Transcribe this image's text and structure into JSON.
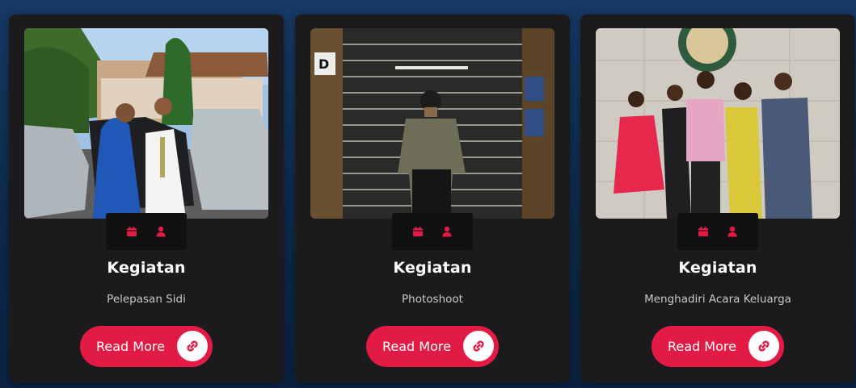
{
  "colors": {
    "accent": "#e21b45",
    "card_bg": "#1b1b1d",
    "meta_bg": "#111112",
    "page_bg": "#163a64"
  },
  "cards": [
    {
      "title": "Kegiatan",
      "description": "Pelepasan Sidi",
      "button_label": "Read More",
      "meta_icons": [
        "calendar-icon",
        "user-icon"
      ],
      "link_icon": "link-icon"
    },
    {
      "title": "Kegiatan",
      "description": "Photoshoot",
      "button_label": "Read More",
      "meta_icons": [
        "calendar-icon",
        "user-icon"
      ],
      "link_icon": "link-icon"
    },
    {
      "title": "Kegiatan",
      "description": "Menghadiri Acara Keluarga",
      "button_label": "Read More",
      "meta_icons": [
        "calendar-icon",
        "user-icon"
      ],
      "link_icon": "link-icon"
    }
  ]
}
